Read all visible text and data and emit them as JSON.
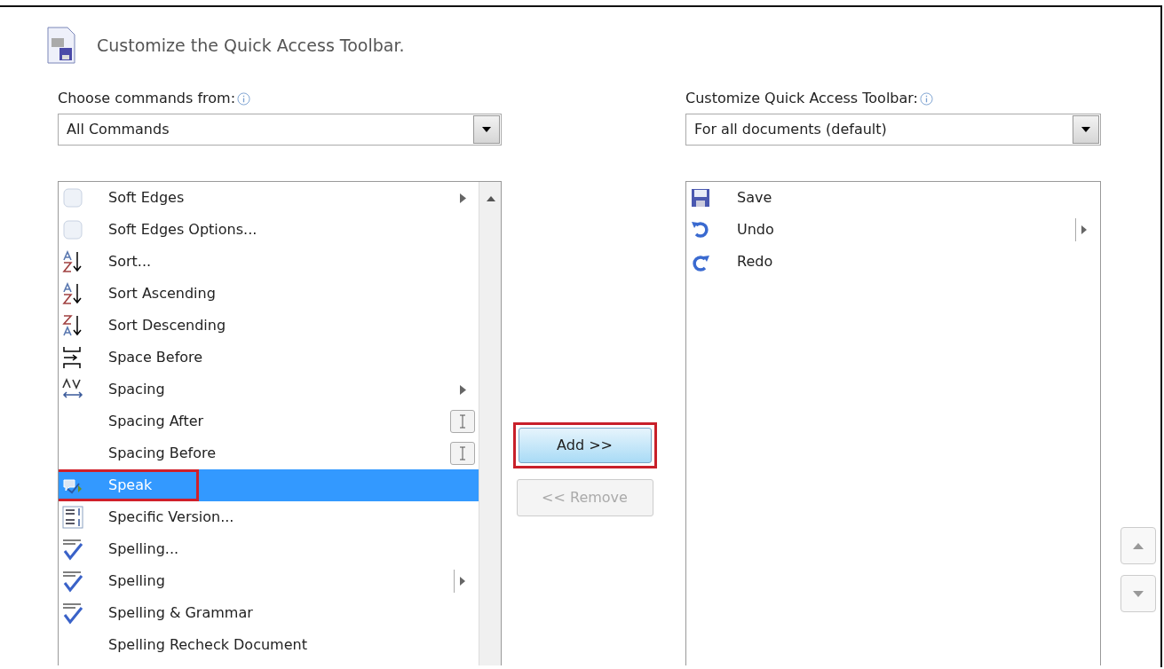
{
  "header": {
    "title": "Customize the Quick Access Toolbar."
  },
  "commands_source": {
    "label": "Choose commands from:",
    "value": "All Commands"
  },
  "toolbar_target": {
    "label": "Customize Quick Access Toolbar:",
    "value": "For all documents (default)"
  },
  "commands": [
    {
      "label": "Soft Edges",
      "kind": "soft-edges",
      "submenu": true,
      "selected": false,
      "highlighted": false
    },
    {
      "label": "Soft Edges Options...",
      "kind": "soft-edges",
      "selected": false,
      "highlighted": false
    },
    {
      "label": "Sort...",
      "kind": "sort-az",
      "selected": false,
      "highlighted": false
    },
    {
      "label": "Sort Ascending",
      "kind": "sort-az",
      "selected": false,
      "highlighted": false
    },
    {
      "label": "Sort Descending",
      "kind": "sort-za",
      "selected": false,
      "highlighted": false
    },
    {
      "label": "Space Before",
      "kind": "space-before",
      "selected": false,
      "highlighted": false
    },
    {
      "label": "Spacing",
      "kind": "spacing",
      "submenu": true,
      "selected": false,
      "highlighted": false
    },
    {
      "label": "Spacing After",
      "field": true,
      "selected": false,
      "highlighted": false
    },
    {
      "label": "Spacing Before",
      "field": true,
      "selected": false,
      "highlighted": false
    },
    {
      "label": "Speak",
      "kind": "speak",
      "selected": true,
      "highlighted": true
    },
    {
      "label": "Specific Version...",
      "kind": "version",
      "selected": false,
      "highlighted": false
    },
    {
      "label": "Spelling...",
      "kind": "spelling",
      "selected": false,
      "highlighted": false
    },
    {
      "label": "Spelling",
      "kind": "spelling",
      "split": true,
      "selected": false,
      "highlighted": false
    },
    {
      "label": "Spelling & Grammar",
      "kind": "spelling",
      "selected": false,
      "highlighted": false
    },
    {
      "label": "Spelling Recheck Document",
      "selected": false,
      "highlighted": false
    }
  ],
  "add_button": {
    "label": "Add >>",
    "disabled": false,
    "highlighted": true
  },
  "remove_button": {
    "label": "<< Remove",
    "disabled": true
  },
  "toolbar_items": [
    {
      "label": "Save",
      "kind": "save"
    },
    {
      "label": "Undo",
      "kind": "undo",
      "split": true
    },
    {
      "label": "Redo",
      "kind": "redo"
    }
  ]
}
